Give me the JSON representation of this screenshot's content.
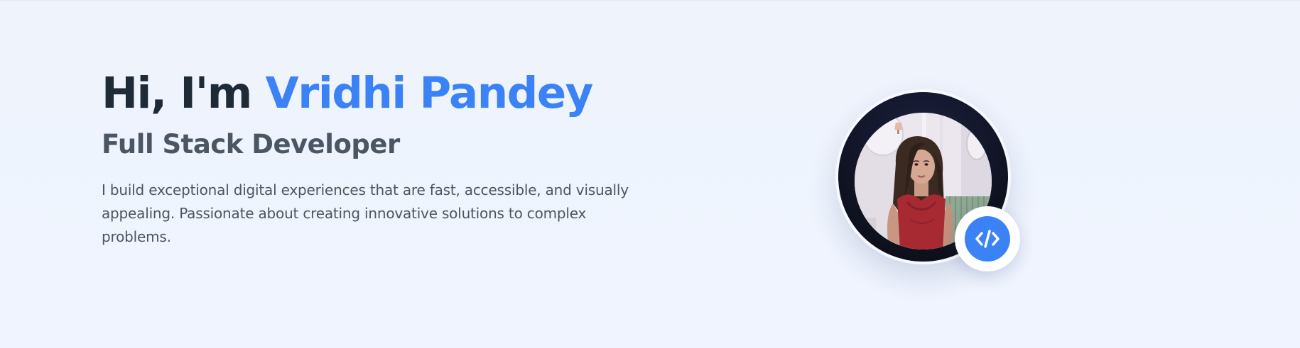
{
  "hero": {
    "greeting_prefix": "Hi, I'm ",
    "name": "Vridhi Pandey",
    "role": "Full Stack Developer",
    "bio": "I build exceptional digital experiences that are fast, accessible, and visually appealing. Passionate about creating innovative solutions to complex problems."
  },
  "avatar": {
    "badge_icon": "code-icon"
  },
  "colors": {
    "accent": "#3b82f6",
    "heading": "#1f2a37",
    "body_text": "#4b5563",
    "background": "#eef3fd"
  }
}
